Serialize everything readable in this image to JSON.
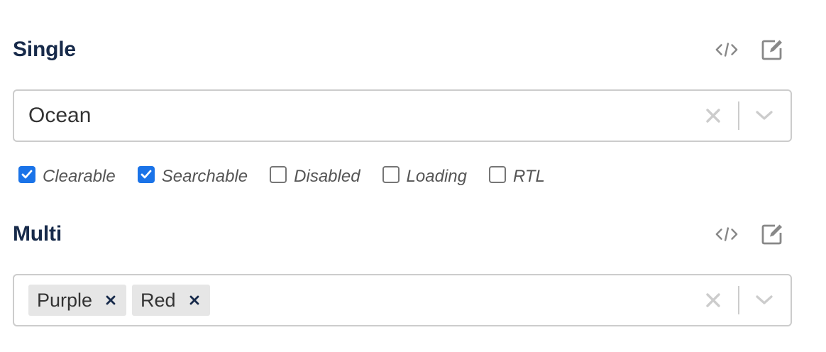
{
  "single": {
    "title": "Single",
    "code_icon": "code-icon",
    "edit_icon": "edit-icon",
    "selected_value": "Ocean",
    "clear_icon": "close-icon",
    "dropdown_icon": "chevron-down-icon"
  },
  "options": [
    {
      "label": "Clearable",
      "checked": true
    },
    {
      "label": "Searchable",
      "checked": true
    },
    {
      "label": "Disabled",
      "checked": false
    },
    {
      "label": "Loading",
      "checked": false
    },
    {
      "label": "RTL",
      "checked": false
    }
  ],
  "multi": {
    "title": "Multi",
    "code_icon": "code-icon",
    "edit_icon": "edit-icon",
    "chips": [
      {
        "label": "Purple"
      },
      {
        "label": "Red"
      }
    ],
    "clear_icon": "close-icon",
    "dropdown_icon": "chevron-down-icon"
  },
  "colors": {
    "title": "#172a4a",
    "checkbox_accent": "#1a73e8",
    "chip_background": "#e6e6e6",
    "chip_remove": "#172a4a",
    "indicator": "#cccccc",
    "border": "#cccccc"
  }
}
